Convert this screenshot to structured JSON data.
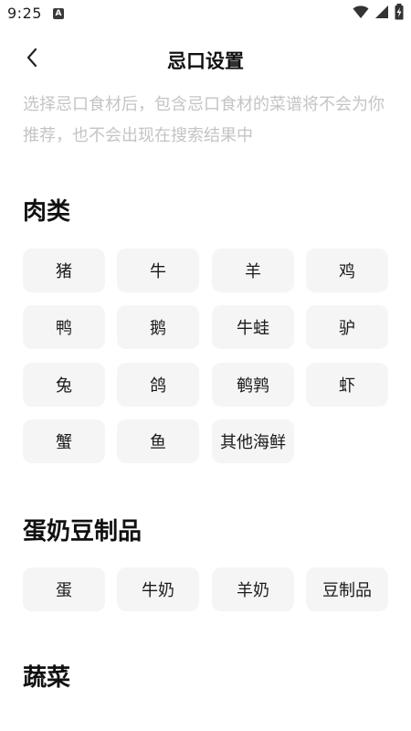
{
  "status_bar": {
    "time": "9:25",
    "app_icon_letter": "A"
  },
  "header": {
    "title": "忌口设置"
  },
  "description": "选择忌口食材后，包含忌口食材的菜谱将不会为你推荐，也不会出现在搜索结果中",
  "sections": {
    "meat": {
      "title": "肉类",
      "items": [
        "猪",
        "牛",
        "羊",
        "鸡",
        "鸭",
        "鹅",
        "牛蛙",
        "驴",
        "兔",
        "鸽",
        "鹌鹑",
        "虾",
        "蟹",
        "鱼",
        "其他海鲜"
      ]
    },
    "eggs_dairy_soy": {
      "title": "蛋奶豆制品",
      "items": [
        "蛋",
        "牛奶",
        "羊奶",
        "豆制品"
      ]
    },
    "vegetables": {
      "title": "蔬菜"
    }
  },
  "icons": {
    "back": "chevron-left-icon",
    "wifi": "wifi-icon",
    "signal": "signal-icon",
    "battery": "battery-charging-icon"
  }
}
